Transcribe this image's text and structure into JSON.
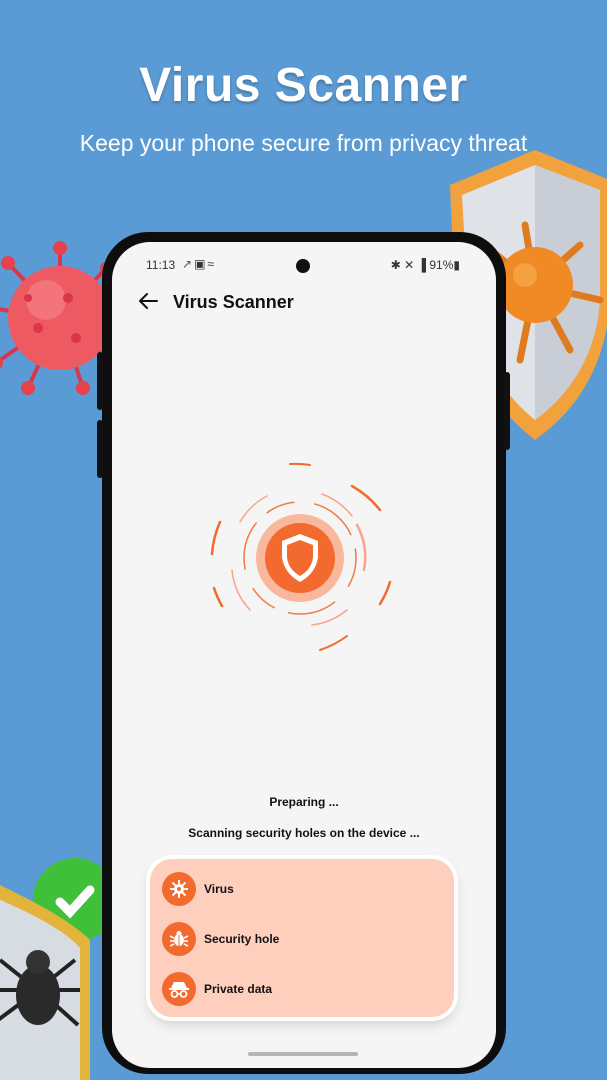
{
  "promo": {
    "title": "Virus Scanner",
    "subtitle": "Keep your phone secure from privacy threat"
  },
  "status_bar": {
    "time": "11:13",
    "battery": "91%",
    "left_icons": [
      "rocket-icon",
      "image-icon",
      "wifi-call-icon"
    ],
    "right_icons": [
      "bluetooth-icon",
      "mute-icon",
      "signal-icon",
      "battery-icon"
    ]
  },
  "app_bar": {
    "back_icon": "arrow-left-icon",
    "title": "Virus Scanner"
  },
  "scan": {
    "status": "Preparing ...",
    "detail": "Scanning security holes on the device ..."
  },
  "checklist": [
    {
      "label": "Virus",
      "icon": "virus-icon"
    },
    {
      "label": "Security hole",
      "icon": "bug-icon"
    },
    {
      "label": "Private data",
      "icon": "incognito-icon"
    }
  ],
  "colors": {
    "background": "#5b9bd5",
    "accent": "#f26a2e",
    "panel": "#ffcfbe"
  }
}
